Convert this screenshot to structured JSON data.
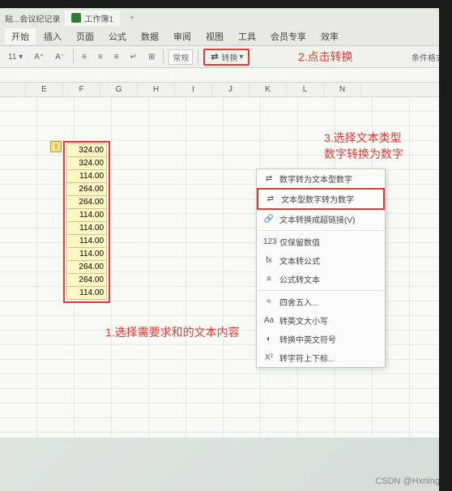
{
  "titlebar": {
    "left_tab": "贴...会议纪记录",
    "doc_name": "工作簿1",
    "plus": "+"
  },
  "menu": {
    "items": [
      "开始",
      "插入",
      "页面",
      "公式",
      "数据",
      "审阅",
      "视图",
      "工具",
      "会员专享",
      "效率"
    ]
  },
  "toolbar": {
    "format_label": "常规",
    "convert_label": "转换",
    "conditional_label": "条件格式"
  },
  "columns": [
    "E",
    "F",
    "G",
    "H",
    "I",
    "J",
    "K",
    "L",
    "N"
  ],
  "selection": {
    "warning": "!",
    "values": [
      "324.00",
      "324.00",
      "114.00",
      "264.00",
      "264.00",
      "114.00",
      "114.00",
      "114.00",
      "114.00",
      "264.00",
      "264.00",
      "114.00"
    ]
  },
  "dropdown": {
    "items": [
      {
        "icon": "⇄",
        "label": "数字转为文本型数字"
      },
      {
        "icon": "⇄",
        "label": "文本型数字转为数字"
      },
      {
        "icon": "🔗",
        "label": "文本转换成超链接(V)"
      },
      {
        "icon": "123",
        "label": "仅保留数值"
      },
      {
        "icon": "fx",
        "label": "文本转公式"
      },
      {
        "icon": "≡",
        "label": "公式转文本"
      },
      {
        "icon": "≈",
        "label": "四舍五入..."
      },
      {
        "icon": "Aa",
        "label": "转英文大小写"
      },
      {
        "icon": "◐",
        "label": "转换中英文符号"
      },
      {
        "icon": "X²",
        "label": "转字符上下标..."
      }
    ]
  },
  "annotations": {
    "a1": "1.选择需要求和的文本内容",
    "a2": "2.点击转换",
    "a3a": "3.选择文本类型",
    "a3b": "数字转换为数字"
  },
  "watermark": "CSDN @Hxning."
}
